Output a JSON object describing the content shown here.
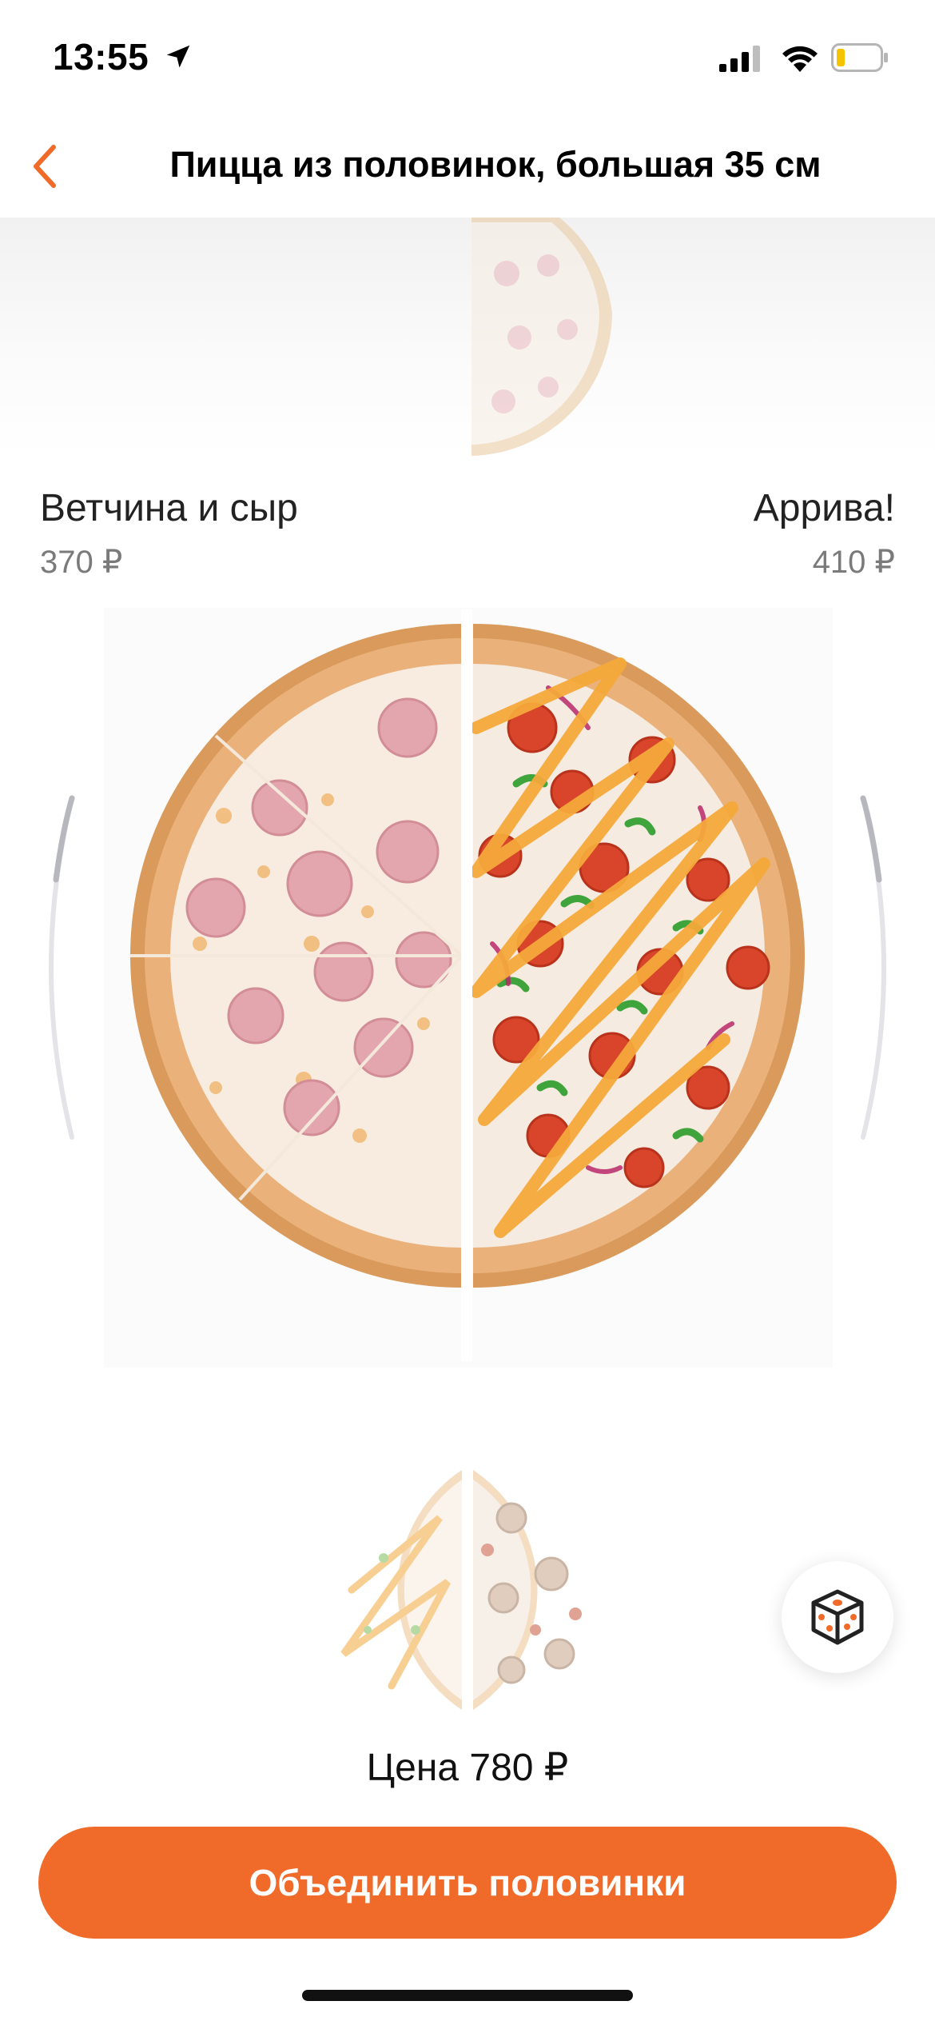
{
  "status_bar": {
    "time": "13:55"
  },
  "nav": {
    "title": "Пицца из половинок, большая 35 см"
  },
  "left_half": {
    "name": "Ветчина и сыр",
    "price": "370 ₽"
  },
  "right_half": {
    "name": "Аррива!",
    "price": "410 ₽"
  },
  "summary": {
    "price_label": "Цена 780 ₽"
  },
  "actions": {
    "combine_label": "Объединить половинки"
  },
  "colors": {
    "accent": "#f06b2a",
    "text_secondary": "#7a7a7a"
  },
  "icons": {
    "back": "chevron-left-icon",
    "random": "dice-icon",
    "location": "location-arrow-icon",
    "signal": "cellular-signal-icon",
    "wifi": "wifi-icon",
    "battery": "battery-icon"
  }
}
